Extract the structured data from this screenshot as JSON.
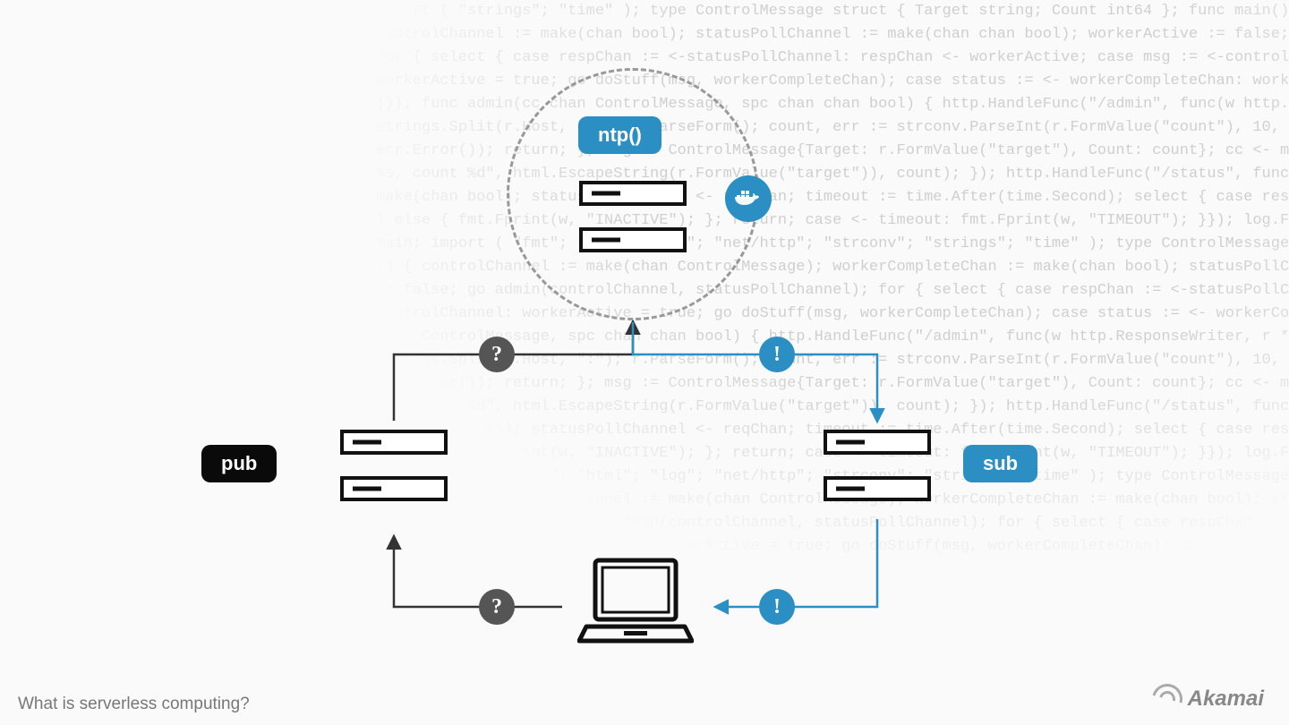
{
  "background_code": "import ( \"strings\"; \"time\" ); type ControlMessage struct { Target string; Count int64 }; func main() {\ncontrolChannel := make(chan bool); statusPollChannel := make(chan chan bool); workerActive := false;\nfor { select { case respChan := <-statusPollChannel: respChan <- workerActive; case msg := <-controlChannel:\nworkerActive = true; go doStuff(msg, workerCompleteChan); case status := <- workerCompleteChan: workerActive = status;\n}}}; func admin(cc chan ControlMessage, spc chan chan bool) { http.HandleFunc(\"/admin\", func(w http.ResponseWriter, r *http.Request) { hostTokens :=\nstrings.Split(r.Host, \":\"); r.ParseForm(); count, err := strconv.ParseInt(r.FormValue(\"count\"), 10, 64); if err != nil { fmt.Fprintf(w,\nerr.Error()); return; }; msg := ControlMessage{Target: r.FormValue(\"target\"), Count: count}; cc <- msg; fmt.Fprintf(w, \"Control message issued for Target\n%s, count %d\", html.EscapeString(r.FormValue(\"target\")), count); }); http.HandleFunc(\"/status\", func(w http.ResponseWriter, r *http.Request) { reqChan :=\nmake(chan bool); statusPollChannel <- reqChan; timeout := time.After(time.Second); select { case result := <-reqChan: if result { fmt.Fprint(w, \"ACTIVE\");\n} else { fmt.Fprint(w, \"INACTIVE\"); }; return; case <- timeout: fmt.Fprint(w, \"TIMEOUT\"); }}); log.Fatal(http.ListenAndServe(\":1337\", nil)); };package\nmain; import ( \"fmt\"; \"html\"; \"log\"; \"net/http\"; \"strconv\"; \"strings\"; \"time\" ); type ControlMessage struct { Target string; Count int64; }; func main\n() { controlChannel := make(chan ControlMessage); workerCompleteChan := make(chan bool); statusPollChannel := make(chan chan bool); workerActive\n:= false; go admin(controlChannel, statusPollChannel); for { select { case respChan := <-statusPollChannel: respChan <- workerActive; case msg := <-\ncontrolChannel: workerActive = true; go doStuff(msg, workerCompleteChan); case status := <- workerCompleteChan: workerActive = status; }}}; func admin(cc\nchan ControlMessage, spc chan chan bool) { http.HandleFunc(\"/admin\", func(w http.ResponseWriter, r *http.Request) { hostTokens :=\nstrings.Split(r.Host, \":\"); r.ParseForm(); count, err := strconv.ParseInt(r.FormValue(\"count\"), 10, 64); if err != nil { fmt.Fprintf(w,\nerr.Error()); return; }; msg := ControlMessage{Target: r.FormValue(\"target\"), Count: count}; cc <- msg; fmt.Fprintf(w, \"Control message issued for Target\n%s, count %d\", html.EscapeString(r.FormValue(\"target\")), count); }); http.HandleFunc(\"/status\", func(w http.ResponseWriter, r *http.Request) { reqChan :=\nmake(chan bool); statusPollChannel <- reqChan; timeout := time.After(time.Second); select { case result := <-reqChan: if result { fmt.Fprint(w, \"ACTIVE\");\n} else { fmt.Fprint(w, \"INACTIVE\"); }; return; case <- timeout: fmt.Fprint(w, \"TIMEOUT\"); }}); log.Fatal(http.ListenAndServe(\":1337\", nil)); };package\nmain; import ( \"fmt\"; \"html\"; \"log\"; \"net/http\"; \"strconv\"; \"strings\"; \"time\" ); type ControlMessage struct { Target string; Count int64; };\nfunc main() { controlChannel := make(chan ControlMessage); workerCompleteChan := make(chan bool); statusPollChannel := make(chan chan bool);\nworkerActive := false; go admin(controlChannel, statusPollChannel); for { select { case respChan := <-statusPollChannel: respChan <- workerActive;\ncase msg := <-controlChannel: workerActive = true; go doStuff(msg, workerCompleteChan); case status := <- workerCompleteChan: workerActive = status;",
  "nodes": {
    "function_badge": "ntp()",
    "publisher_badge": "pub",
    "subscriber_badge": "sub"
  },
  "markers": {
    "question": "?",
    "event": "!"
  },
  "footer": "What is serverless computing?",
  "brand": "Akamai",
  "colors": {
    "blue": "#2b8fc4",
    "gray": "#555555",
    "black": "#0a0a0a",
    "line_dark": "#333333"
  },
  "diagram": {
    "description": "Serverless pub/sub architecture. Top: dashed circle (ephemeral container) holding ntp() function + Docker icon + servers. Left: 'pub' server stack publishes (?) up to function. Right: function delivers (!) down to 'sub' server stack. Sub delivers (!) to laptop at bottom center. Laptop sends (?) back to pub, completing the loop.",
    "flow": [
      {
        "from": "publisher",
        "to": "function-container",
        "marker": "question",
        "style": "dark"
      },
      {
        "from": "function-container",
        "to": "subscriber",
        "marker": "event",
        "style": "blue"
      },
      {
        "from": "subscriber",
        "to": "laptop",
        "marker": "event",
        "style": "blue"
      },
      {
        "from": "laptop",
        "to": "publisher",
        "marker": "question",
        "style": "dark"
      }
    ]
  }
}
